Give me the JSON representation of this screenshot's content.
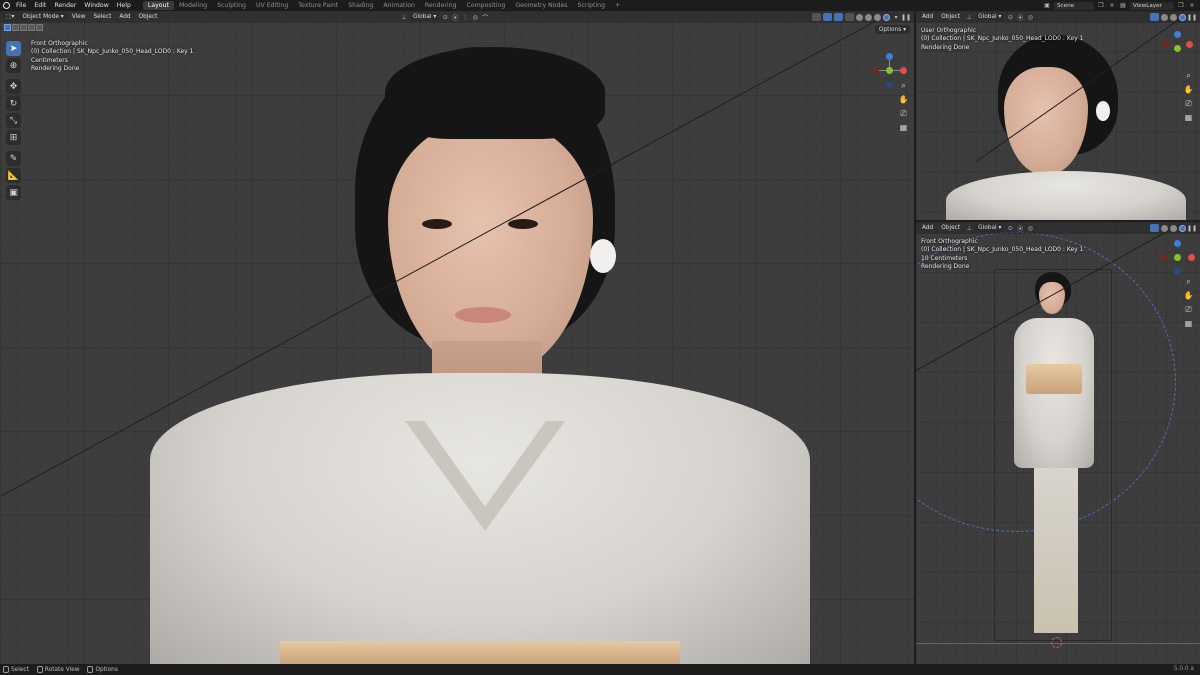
{
  "topbar": {
    "menus": [
      "File",
      "Edit",
      "Render",
      "Window",
      "Help"
    ],
    "workspaces": [
      "Layout",
      "Modeling",
      "Sculpting",
      "UV Editing",
      "Texture Paint",
      "Shading",
      "Animation",
      "Rendering",
      "Compositing",
      "Geometry Nodes",
      "Scripting"
    ],
    "active_workspace": "Layout",
    "scene": "Scene",
    "view_layer": "ViewLayer"
  },
  "main_viewport": {
    "mode": "Object Mode",
    "menus": [
      "View",
      "Select",
      "Add",
      "Object"
    ],
    "orientation": "Global",
    "options_label": "Options",
    "overlay": {
      "view_name": "Front Orthographic",
      "collection": "(0) Collection | SK_Npc_Junko_050_Head_LOD0 : Key 1",
      "units": "Centimeters",
      "status": "Rendering Done"
    }
  },
  "top_right_viewport": {
    "menus": [
      "Add",
      "Object"
    ],
    "orientation": "Global",
    "overlay": {
      "view_name": "User Orthographic",
      "collection": "(0) Collection | SK_Npc_Junko_050_Head_LOD0 : Key 1",
      "status": "Rendering Done"
    }
  },
  "bottom_right_viewport": {
    "menus": [
      "Add",
      "Object"
    ],
    "orientation": "Global",
    "overlay": {
      "view_name": "Front Orthographic",
      "collection": "(0) Collection | SK_Npc_Junko_050_Head_LOD0 : Key 1",
      "units": "10 Centimeters",
      "status": "Rendering Done"
    }
  },
  "statusbar": {
    "select": "Select",
    "rotate": "Rotate View",
    "options": "Options",
    "version": "5.0.0 a"
  },
  "colors": {
    "accent": "#4772b3",
    "axis_x": "#e8494b",
    "axis_y": "#86c22b",
    "axis_z": "#3d7fd9"
  }
}
